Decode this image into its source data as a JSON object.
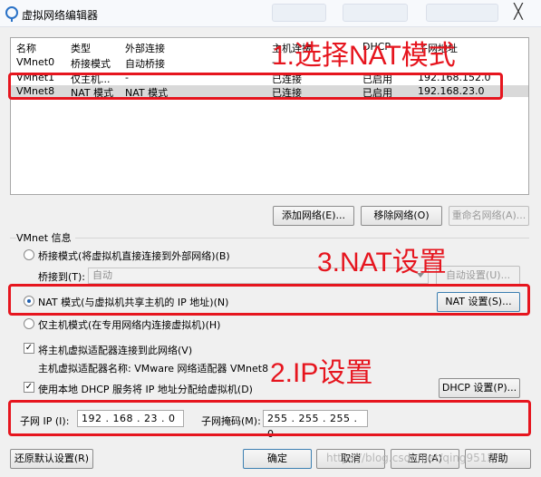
{
  "window": {
    "title": "虚拟网络编辑器",
    "close_glyph": "╳"
  },
  "table": {
    "headers": [
      "名称",
      "类型",
      "外部连接",
      "主机连接",
      "DHCP",
      "子网地址"
    ],
    "rows": [
      [
        "VMnet0",
        "桥接模式",
        "自动桥接",
        "-",
        "-",
        ""
      ],
      [
        "VMnet1",
        "仅主机...",
        "-",
        "已连接",
        "已启用",
        "192.168.152.0"
      ],
      [
        "VMnet8",
        "NAT 模式",
        "NAT 模式",
        "已连接",
        "已启用",
        "192.168.23.0"
      ]
    ],
    "selected_row": 2
  },
  "table_buttons": {
    "add": "添加网络(E)...",
    "remove": "移除网络(O)",
    "rename": "重命名网络(A)..."
  },
  "vmnet_info": {
    "label": "VMnet 信息",
    "bridge_option": "桥接模式(将虚拟机直接连接到外部网络)(B)",
    "bridge_to_label": "桥接到(T):",
    "bridge_to_value": "自动",
    "auto_settings": "自动设置(U)...",
    "nat_option": "NAT 模式(与虚拟机共享主机的 IP 地址)(N)",
    "nat_settings": "NAT 设置(S)...",
    "host_only_option": "仅主机模式(在专用网络内连接虚拟机)(H)",
    "connect_adapter": "将主机虚拟适配器连接到此网络(V)",
    "adapter_name": "主机虚拟适配器名称: VMware 网络适配器 VMnet8",
    "use_dhcp": "使用本地 DHCP 服务将 IP 地址分配给虚拟机(D)",
    "dhcp_settings": "DHCP 设置(P)...",
    "subnet_ip_label": "子网 IP (I):",
    "subnet_ip": "192 . 168 . 23 . 0",
    "subnet_mask_label": "子网掩码(M):",
    "subnet_mask": "255 . 255 . 255 . 0"
  },
  "bottom_buttons": {
    "restore": "还原默认设置(R)",
    "ok": "确定",
    "cancel": "取消",
    "apply": "应用(A)",
    "help": "帮助"
  },
  "annotations": {
    "step1": "1.选择NAT模式",
    "step2": "2.IP设置",
    "step3": "3.NAT设置"
  },
  "watermark": "https://blog.csdn.net/qing9512",
  "colors": {
    "annotation_red": "#e6151e",
    "selected_row": "#d9d9d9",
    "window_bg": "#f0f0f0"
  }
}
